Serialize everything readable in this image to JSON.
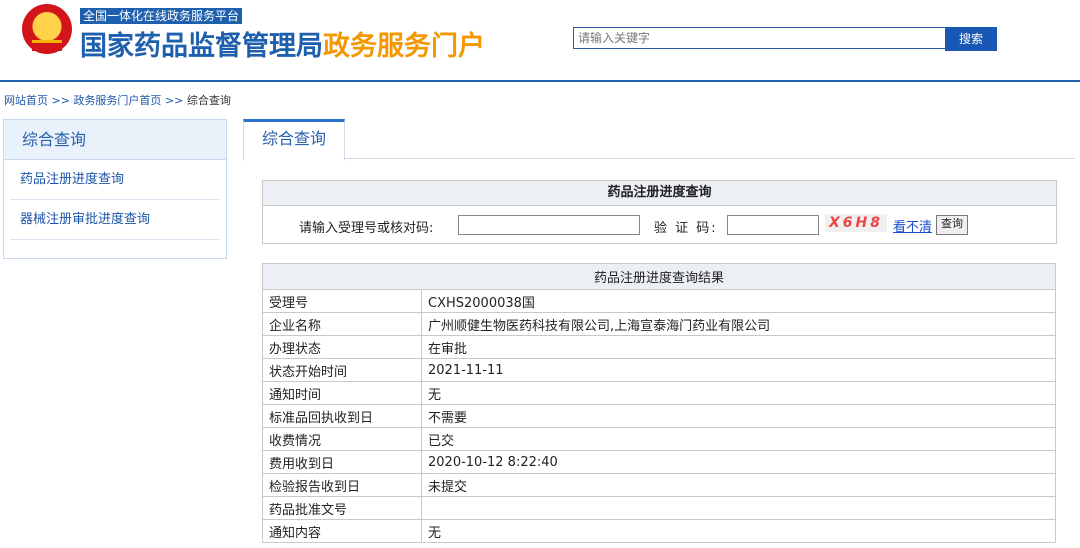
{
  "header": {
    "subtitle": "全国一体化在线政务服务平台",
    "title_main": "国家药品监督管理局",
    "title_accent": "政务服务门户",
    "search_placeholder": "请输入关键字",
    "search_button": "搜索"
  },
  "breadcrumb": {
    "links": [
      "网站首页",
      "政务服务门户首页"
    ],
    "separator": ">>",
    "current": "综合查询"
  },
  "sidebar": {
    "heading": "综合查询",
    "items": [
      "药品注册进度查询",
      "器械注册审批进度查询"
    ]
  },
  "tab": {
    "label": "综合查询"
  },
  "query": {
    "title": "药品注册进度查询",
    "id_label": "请输入受理号或核对码:",
    "captcha_label": "验 证 码:",
    "captcha_text": "X6H8",
    "refresh_link": "看不清",
    "query_button": "查询"
  },
  "result": {
    "title": "药品注册进度查询结果",
    "rows": [
      {
        "key": "受理号",
        "value": "CXHS2000038国"
      },
      {
        "key": "企业名称",
        "value": "广州顺健生物医药科技有限公司,上海宣泰海门药业有限公司"
      },
      {
        "key": "办理状态",
        "value": "在审批"
      },
      {
        "key": "状态开始时间",
        "value": "2021-11-11"
      },
      {
        "key": "通知时间",
        "value": "无"
      },
      {
        "key": "标准品回执收到日",
        "value": "不需要"
      },
      {
        "key": "收费情况",
        "value": "已交"
      },
      {
        "key": "费用收到日",
        "value": "2020-10-12 8:22:40"
      },
      {
        "key": "检验报告收到日",
        "value": "未提交"
      },
      {
        "key": "药品批准文号",
        "value": ""
      },
      {
        "key": "通知内容",
        "value": "无"
      }
    ]
  },
  "colors": {
    "brand_blue": "#1e5fae",
    "accent_orange": "#f39800",
    "captcha_red": "#e44444"
  }
}
